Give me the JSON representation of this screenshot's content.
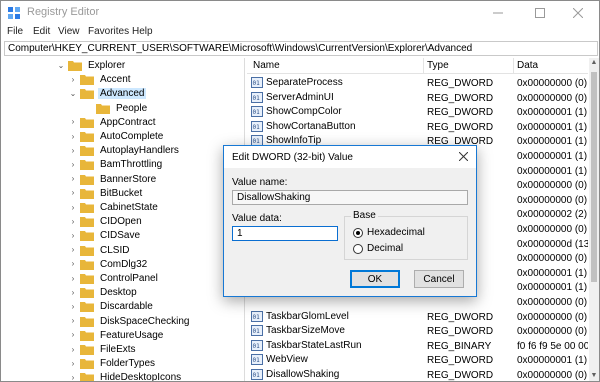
{
  "window": {
    "title": "Registry Editor"
  },
  "menu": [
    "File",
    "Edit",
    "View",
    "Favorites",
    "Help"
  ],
  "address": "Computer\\HKEY_CURRENT_USER\\SOFTWARE\\Microsoft\\Windows\\CurrentVersion\\Explorer\\Advanced",
  "tree": [
    {
      "label": "Explorer",
      "expanded": true,
      "level": 0
    },
    {
      "label": "Accent",
      "level": 1
    },
    {
      "label": "Advanced",
      "expanded": true,
      "selected": true,
      "level": 1
    },
    {
      "label": "People",
      "level": 2
    },
    {
      "label": "AppContract",
      "level": 1
    },
    {
      "label": "AutoComplete",
      "level": 1
    },
    {
      "label": "AutoplayHandlers",
      "level": 1
    },
    {
      "label": "BamThrottling",
      "level": 1
    },
    {
      "label": "BannerStore",
      "level": 1
    },
    {
      "label": "BitBucket",
      "level": 1
    },
    {
      "label": "CabinetState",
      "level": 1
    },
    {
      "label": "CIDOpen",
      "level": 1
    },
    {
      "label": "CIDSave",
      "level": 1
    },
    {
      "label": "CLSID",
      "level": 1
    },
    {
      "label": "ComDlg32",
      "level": 1
    },
    {
      "label": "ControlPanel",
      "level": 1
    },
    {
      "label": "Desktop",
      "level": 1
    },
    {
      "label": "Discardable",
      "level": 1
    },
    {
      "label": "DiskSpaceChecking",
      "level": 1
    },
    {
      "label": "FeatureUsage",
      "level": 1
    },
    {
      "label": "FileExts",
      "level": 1
    },
    {
      "label": "FolderTypes",
      "level": 1
    },
    {
      "label": "HideDesktopIcons",
      "level": 1
    }
  ],
  "list": {
    "headers": {
      "name": "Name",
      "type": "Type",
      "data": "Data"
    },
    "rows": [
      {
        "name": "SeparateProcess",
        "type": "REG_DWORD",
        "data": "0x00000000 (0)"
      },
      {
        "name": "ServerAdminUI",
        "type": "REG_DWORD",
        "data": "0x00000000 (0)"
      },
      {
        "name": "ShowCompColor",
        "type": "REG_DWORD",
        "data": "0x00000001 (1)"
      },
      {
        "name": "ShowCortanaButton",
        "type": "REG_DWORD",
        "data": "0x00000001 (1)"
      },
      {
        "name": "ShowInfoTip",
        "type": "REG_DWORD",
        "data": "0x00000001 (1)"
      },
      {
        "name": "",
        "type": "",
        "data": "0x00000001 (1)"
      },
      {
        "name": "",
        "type": "",
        "data": "0x00000001 (1)"
      },
      {
        "name": "",
        "type": "",
        "data": "0x00000000 (0)"
      },
      {
        "name": "",
        "type": "",
        "data": "0x00000000 (0)"
      },
      {
        "name": "",
        "type": "",
        "data": "0x00000002 (2)"
      },
      {
        "name": "",
        "type": "",
        "data": "0x00000000 (0)"
      },
      {
        "name": "",
        "type": "",
        "data": "0x0000000d (13)"
      },
      {
        "name": "",
        "type": "",
        "data": "0x00000000 (0)"
      },
      {
        "name": "",
        "type": "",
        "data": "0x00000001 (1)"
      },
      {
        "name": "",
        "type": "",
        "data": "0x00000001 (1)"
      },
      {
        "name": "",
        "type": "",
        "data": "0x00000000 (0)"
      },
      {
        "name": "TaskbarGlomLevel",
        "type": "REG_DWORD",
        "data": "0x00000000 (0)"
      },
      {
        "name": "TaskbarSizeMove",
        "type": "REG_DWORD",
        "data": "0x00000000 (0)"
      },
      {
        "name": "TaskbarStateLastRun",
        "type": "REG_BINARY",
        "data": "f0 f6 f9 5e 00 00 0"
      },
      {
        "name": "WebView",
        "type": "REG_DWORD",
        "data": "0x00000001 (1)"
      },
      {
        "name": "DisallowShaking",
        "type": "REG_DWORD",
        "data": "0x00000000 (0)"
      }
    ]
  },
  "dialog": {
    "title": "Edit DWORD (32-bit) Value",
    "value_name_label": "Value name:",
    "value_name": "DisallowShaking",
    "value_data_label": "Value data:",
    "value_data": "1",
    "base_label": "Base",
    "hex_label": "Hexadecimal",
    "dec_label": "Decimal",
    "ok_label": "OK",
    "cancel_label": "Cancel",
    "selected_base": "Hexadecimal"
  },
  "colors": {
    "accent": "#0078d7",
    "folder": "#e8b63a",
    "selection": "#cde8ff"
  }
}
